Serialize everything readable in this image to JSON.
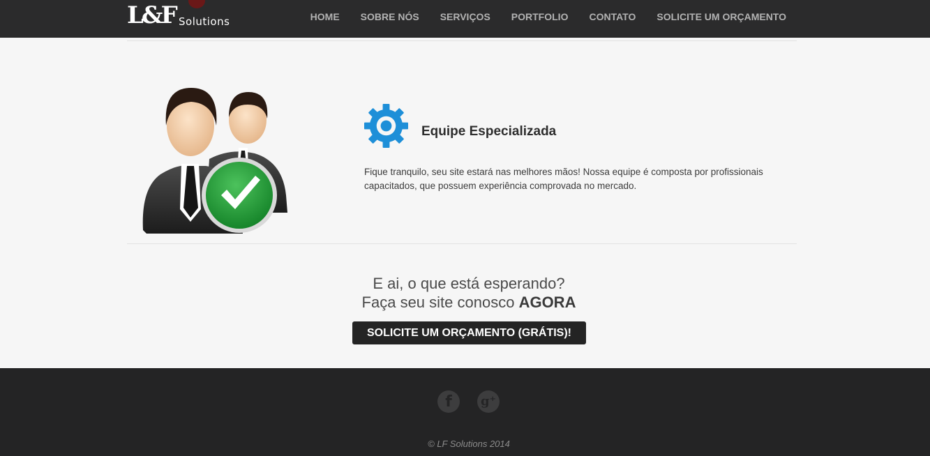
{
  "header": {
    "logo": {
      "mark": "L&F",
      "sub": "Solutions"
    },
    "nav": [
      "HOME",
      "SOBRE NÓS",
      "SERVIÇOS",
      "PORTFOLIO",
      "CONTATO",
      "SOLICITE UM ORÇAMENTO"
    ]
  },
  "feature": {
    "illustration_icon": "team-check-icon",
    "icon": "gear-icon",
    "title": "Equipe Especializada",
    "text": "Fique tranquilo, seu site estará nas melhores mãos! Nossa equipe é composta por profissionais capacitados, que possuem experiência comprovada no mercado."
  },
  "cta": {
    "line1": "E ai, o que está esperando?",
    "line2_prefix": "Faça seu site conosco ",
    "line2_bold": "AGORA",
    "button": "SOLICITE UM ORÇAMENTO (GRÁTIS)!"
  },
  "footer": {
    "social": [
      {
        "icon": "facebook-icon",
        "glyph": "f"
      },
      {
        "icon": "google-plus-icon",
        "glyph": "g⁺"
      }
    ],
    "copyright": "© LF Solutions 2014"
  },
  "colors": {
    "header_bg": "#2b2b2c",
    "footer_bg": "#242425",
    "accent_blue": "#1e8fd8",
    "check_green": "#2ea043",
    "button_bg": "#242424"
  }
}
